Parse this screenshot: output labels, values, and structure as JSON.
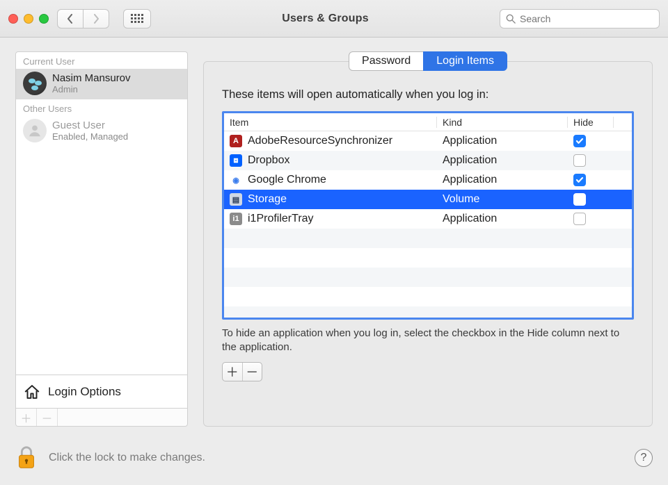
{
  "window": {
    "title": "Users & Groups"
  },
  "search": {
    "placeholder": "Search"
  },
  "sidebar": {
    "section_current": "Current User",
    "section_other": "Other Users",
    "current_user": {
      "name": "Nasim Mansurov",
      "role": "Admin"
    },
    "other_user": {
      "name": "Guest User",
      "role": "Enabled, Managed"
    },
    "login_options": "Login Options"
  },
  "tabs": {
    "password": "Password",
    "login_items": "Login Items"
  },
  "panel": {
    "intro": "These items will open automatically when you log in:",
    "columns": {
      "item": "Item",
      "kind": "Kind",
      "hide": "Hide"
    },
    "rows": [
      {
        "name": "AdobeResourceSynchronizer",
        "kind": "Application",
        "hide": true,
        "selected": false,
        "icon": {
          "bg": "#b0201e",
          "fg": "#fff",
          "glyph": "A"
        }
      },
      {
        "name": "Dropbox",
        "kind": "Application",
        "hide": false,
        "selected": false,
        "icon": {
          "bg": "#0061ff",
          "fg": "#fff",
          "glyph": "⧈"
        }
      },
      {
        "name": "Google Chrome",
        "kind": "Application",
        "hide": true,
        "selected": false,
        "icon": {
          "bg": "#ffffff",
          "fg": "#3b7ded",
          "glyph": "◉"
        }
      },
      {
        "name": "Storage",
        "kind": "Volume",
        "hide": false,
        "selected": true,
        "icon": {
          "bg": "#cfd7e4",
          "fg": "#2a3a55",
          "glyph": "▤"
        }
      },
      {
        "name": "i1ProfilerTray",
        "kind": "Application",
        "hide": false,
        "selected": false,
        "icon": {
          "bg": "#8b8b8b",
          "fg": "#fff",
          "glyph": "i1"
        }
      }
    ],
    "hint": "To hide an application when you log in, select the checkbox in the Hide column next to the application."
  },
  "footer": {
    "lock_text": "Click the lock to make changes."
  }
}
